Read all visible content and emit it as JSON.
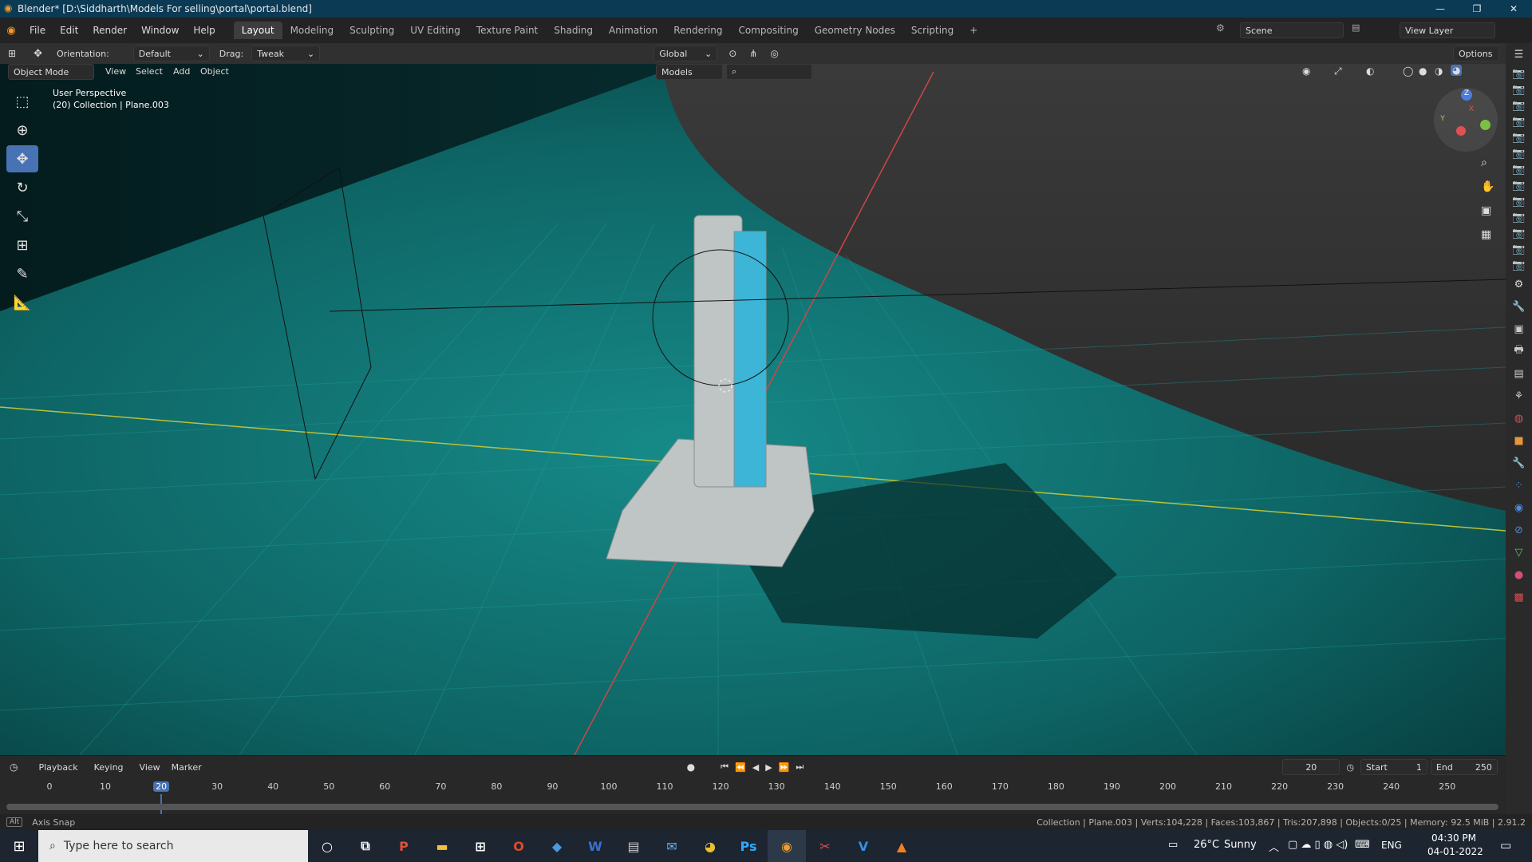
{
  "window": {
    "title": "Blender* [D:\\Siddharth\\Models For selling\\portal\\portal.blend]",
    "controls": [
      "—",
      "❐",
      "✕"
    ]
  },
  "menu": {
    "items": [
      "File",
      "Edit",
      "Render",
      "Window",
      "Help"
    ],
    "workspaces": [
      "Layout",
      "Modeling",
      "Sculpting",
      "UV Editing",
      "Texture Paint",
      "Shading",
      "Animation",
      "Rendering",
      "Compositing",
      "Geometry Nodes",
      "Scripting"
    ],
    "active_workspace": "Layout",
    "add_tab": "+",
    "scene_label": "Scene",
    "view_layer_label": "View Layer"
  },
  "tool_header": {
    "orientation_label": "Orientation:",
    "orientation_value": "Default",
    "drag_label": "Drag:",
    "drag_value": "Tweak",
    "transform_orientation": "Global",
    "options_label": "Options"
  },
  "viewport_header": {
    "mode": "Object Mode",
    "menus": [
      "View",
      "Select",
      "Add",
      "Object"
    ],
    "filter_value": "Models"
  },
  "viewport": {
    "perspective_label": "User Perspective",
    "collection_label": "(20) Collection | Plane.003",
    "gizmo_axes": [
      "Z",
      "Y",
      "X"
    ]
  },
  "timeline": {
    "menus": [
      "Playback",
      "Keying",
      "View",
      "Marker"
    ],
    "current_frame": "20",
    "start_label": "Start",
    "start_value": "1",
    "end_label": "End",
    "end_value": "250",
    "ruler_ticks": [
      "0",
      "10",
      "20",
      "30",
      "40",
      "50",
      "60",
      "70",
      "80",
      "90",
      "100",
      "110",
      "120",
      "130",
      "140",
      "150",
      "160",
      "170",
      "180",
      "190",
      "200",
      "210",
      "220",
      "230",
      "240",
      "250"
    ]
  },
  "status": {
    "left": "Axis Snap",
    "key_hint": "Alt",
    "right": "Collection | Plane.003 | Verts:104,228 | Faces:103,867 | Tris:207,898 | Objects:0/25 | Memory: 92.5 MiB | 2.91.2"
  },
  "taskbar": {
    "search_placeholder": "Type here to search",
    "temperature": "26°C",
    "weather": "Sunny",
    "language": "ENG",
    "time": "04:30 PM",
    "date": "04-01-2022"
  },
  "colors": {
    "accent": "#4772b3",
    "floor": "#0f6a6a",
    "title_bar": "#0b3a55",
    "frame_marker": "#4772b3"
  }
}
